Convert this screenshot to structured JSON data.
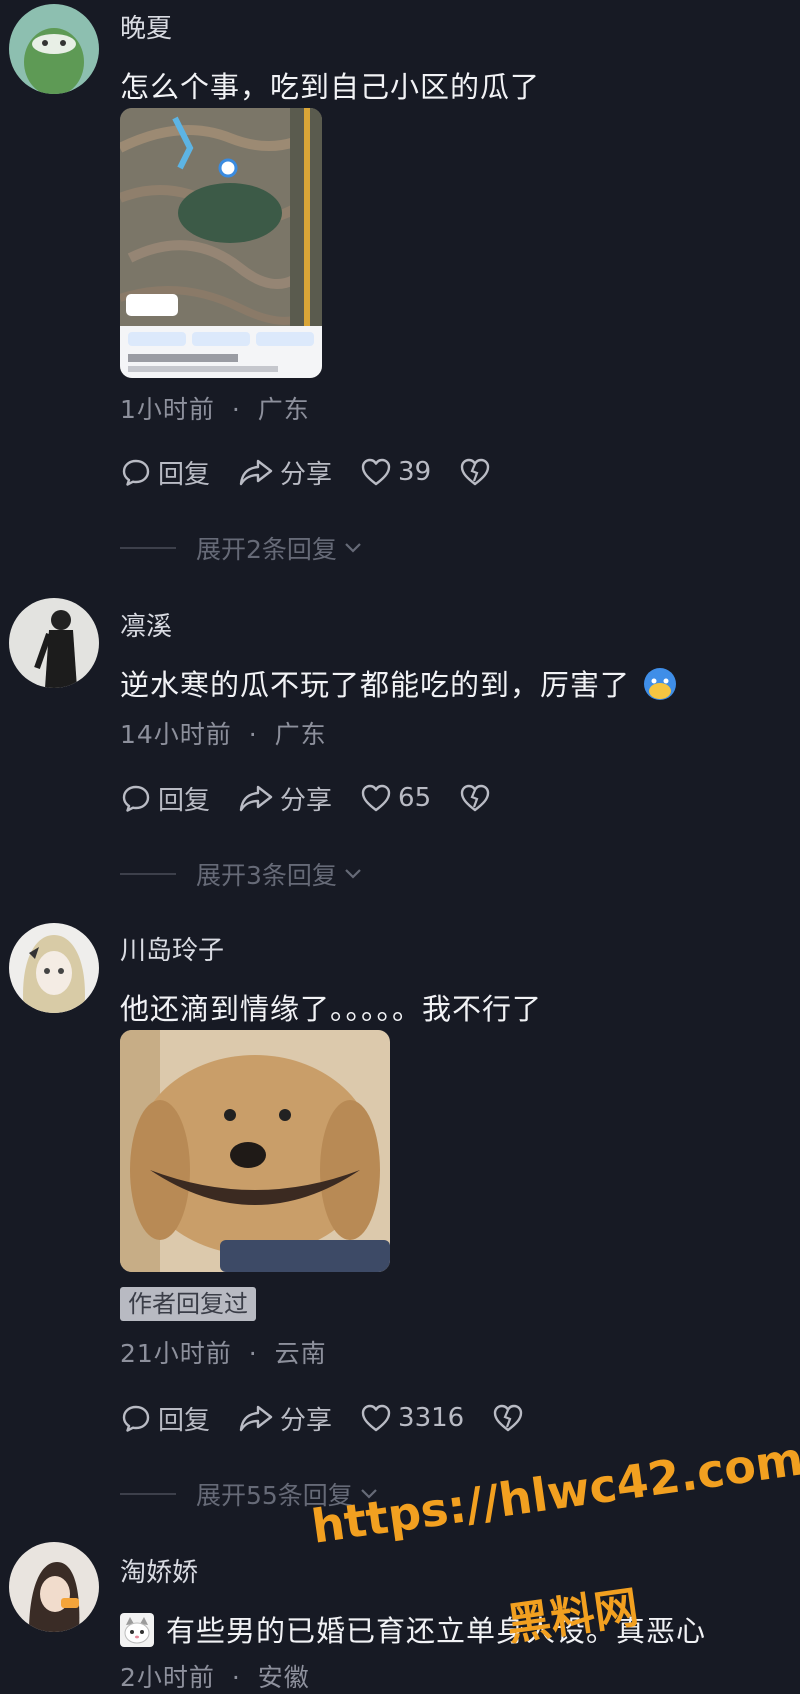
{
  "comments": [
    {
      "username": "晚夏",
      "text": "怎么个事，吃到自己小区的瓜了",
      "time": "1小时前",
      "location": "广东",
      "reply_label": "回复",
      "share_label": "分享",
      "likes": "39",
      "expand_label": "展开2条回复"
    },
    {
      "username": "凛溪",
      "text": "逆水寒的瓜不玩了都能吃的到，厉害了",
      "time": "14小时前",
      "location": "广东",
      "reply_label": "回复",
      "share_label": "分享",
      "likes": "65",
      "expand_label": "展开3条回复"
    },
    {
      "username": "川岛玲子",
      "text": "他还滴到情缘了。。。。。我不行了",
      "badge": "作者回复过",
      "time": "21小时前",
      "location": "云南",
      "reply_label": "回复",
      "share_label": "分享",
      "likes": "3316",
      "expand_label": "展开55条回复"
    },
    {
      "username": "淘娇娇",
      "text": "有些男的已婚已育还立单身人设。真恶心",
      "time": "2小时前",
      "location": "安徽"
    }
  ],
  "separator": "·",
  "watermark": {
    "url": "https://hlwc42.com",
    "name": "黑料网"
  },
  "colors": {
    "background": "#171a24",
    "watermark": "#f2a020"
  },
  "icons": [
    "reply-icon",
    "share-icon",
    "heart-icon",
    "dislike-icon",
    "chevron-down-icon"
  ]
}
